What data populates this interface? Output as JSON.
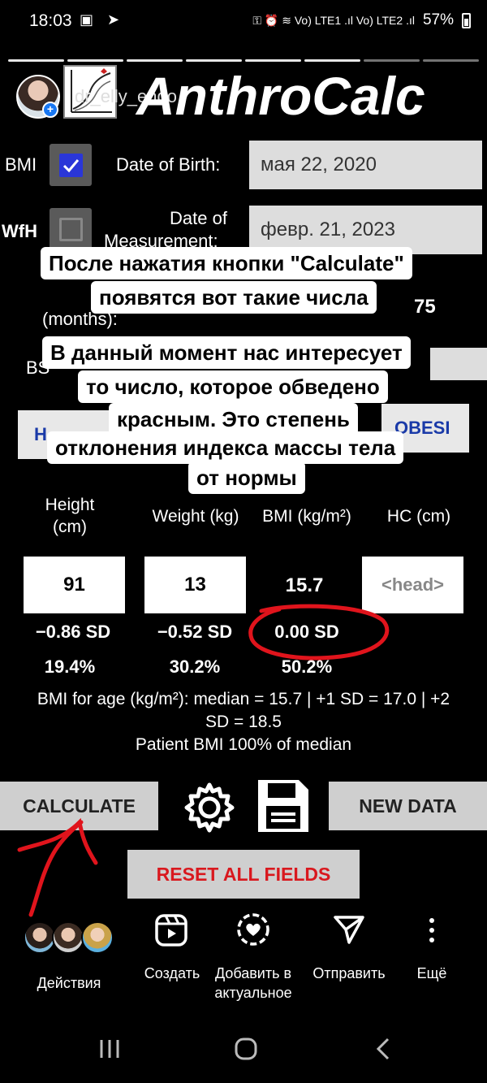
{
  "status": {
    "time": "18:03",
    "left_icons": "▣ ➤",
    "right_icons": "⚿ ⏰ ≋ Vo) LTE1 .ıl Vo) LTE2 .ıl",
    "battery": "57%"
  },
  "header": {
    "username": "dr_elly_endo",
    "app_title": "AnthroCalc"
  },
  "form": {
    "bmi_label": "BMI",
    "bmi_checked": true,
    "wfh_label": "WfH",
    "wfh_checked": false,
    "dob_label": "Date of Birth:",
    "dob_value": "мая 22, 2020",
    "dom_label_1": "Date of",
    "dom_label_2": "Measurement:",
    "dom_value": "февр. 21, 2023",
    "age_months_label": "(months):",
    "age_value_partial": "75",
    "bs_partial": "BS",
    "tab_left_partial": "H",
    "tab_right_partial": "OBESI"
  },
  "captions": {
    "c1_line1": "После нажатия кнопки \"Calculate\"",
    "c1_line2": "появятся вот такие числа",
    "c2_line1": "В данный момент нас интересует",
    "c2_line2": "то число, которое обведено",
    "c2_line3": "красным. Это степень",
    "c2_line4": "отклонения индекса массы тела",
    "c2_line5": "от нормы"
  },
  "measurements": {
    "height_head_1": "Height",
    "height_head_2": "(cm)",
    "weight_head": "Weight (kg)",
    "bmi_head": "BMI (kg/m²)",
    "hc_head": "HC (cm)",
    "height_value": "91",
    "weight_value": "13",
    "bmi_value": "15.7",
    "hc_placeholder": "<head>",
    "height_sd": "−0.86 SD",
    "weight_sd": "−0.52 SD",
    "bmi_sd": "0.00 SD",
    "height_pct": "19.4%",
    "weight_pct": "30.2%",
    "bmi_pct": "50.2%"
  },
  "info": {
    "line1": "BMI for age (kg/m²): median = 15.7 | +1 SD = 17.0 | +2",
    "line2": "SD = 18.5",
    "line3": "Patient BMI 100% of median"
  },
  "buttons": {
    "calculate": "CALCULATE",
    "settings_icon": "⚙",
    "save_icon": "save-icon",
    "new_data": "NEW DATA",
    "reset": "RESET ALL FIELDS"
  },
  "story_bar": {
    "activity_label": "Действия",
    "create_label": "Создать",
    "highlight_label_1": "Добавить в",
    "highlight_label_2": "актуальное",
    "send_label": "Отправить",
    "more_label": "Ещё"
  },
  "colors": {
    "annotation_red": "#e0141c",
    "checkbox_blue": "#2a36d8",
    "reset_red": "#d9181e"
  }
}
